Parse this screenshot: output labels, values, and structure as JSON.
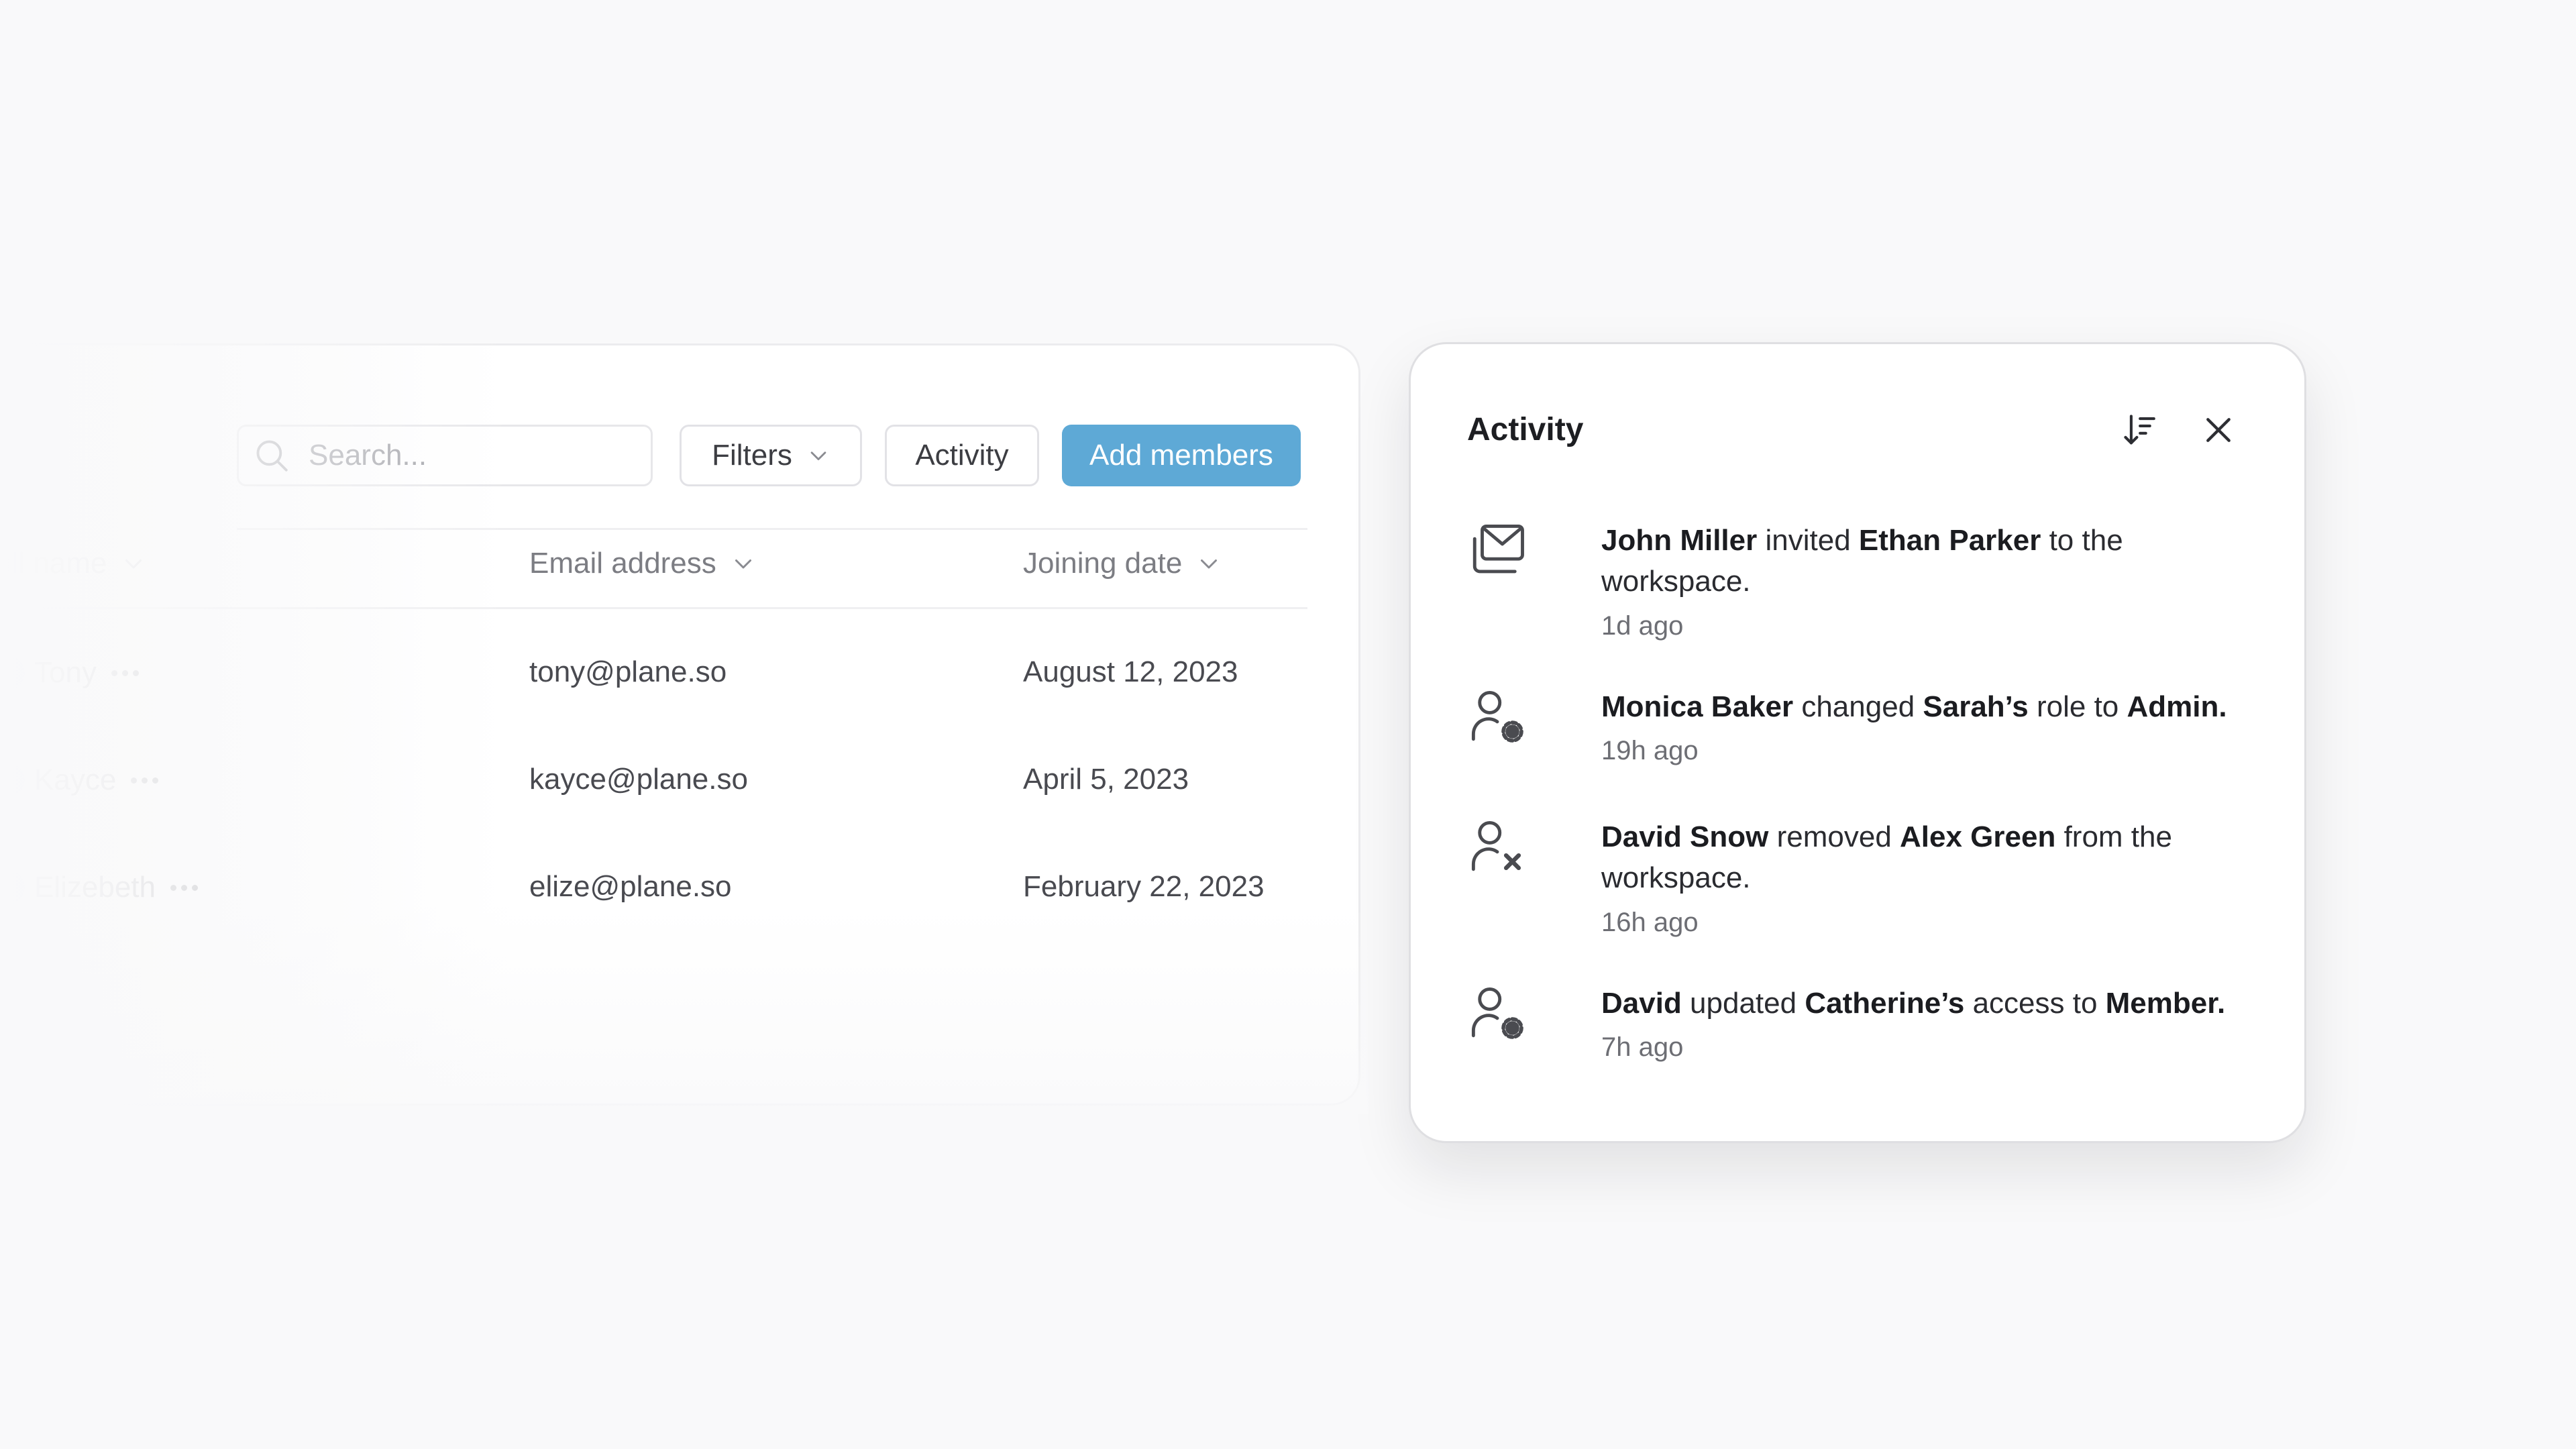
{
  "toolbar": {
    "search_placeholder": "Search...",
    "filters_label": "Filters",
    "activity_label": "Activity",
    "add_members_label": "Add members"
  },
  "table": {
    "columns": [
      "ull name",
      "Email address",
      "Joining date"
    ],
    "rows": [
      {
        "name": "Tony",
        "email": "tony@plane.so",
        "date": "August 12, 2023"
      },
      {
        "name": "Kayce",
        "email": "kayce@plane.so",
        "date": "April 5, 2023"
      },
      {
        "name": "Elizebeth",
        "email": "elize@plane.so",
        "date": "February 22, 2023"
      }
    ]
  },
  "activity": {
    "title": "Activity",
    "items": [
      {
        "icon": "mail-icon",
        "actor": "John Miller",
        "verb": " invited ",
        "target": "Ethan Parker",
        "mid": " to the workspace.",
        "value": "",
        "end": "",
        "time": "1d ago"
      },
      {
        "icon": "user-settings-icon",
        "actor": "Monica Baker",
        "verb": " changed ",
        "target": "Sarah’s",
        "mid": " role to ",
        "value": "Admin.",
        "end": "",
        "time": "19h ago"
      },
      {
        "icon": "user-remove-icon",
        "actor": "David Snow",
        "verb": " removed ",
        "target": "Alex Green",
        "mid": " from the workspace.",
        "value": "",
        "end": "",
        "time": "16h ago"
      },
      {
        "icon": "user-settings-icon",
        "actor": "David",
        "verb": " updated ",
        "target": "Catherine’s",
        "mid": " access to ",
        "value": "Member.",
        "end": "",
        "time": "7h ago"
      }
    ]
  },
  "colors": {
    "accent": "#5ea9d6",
    "background": "#f9f9fa",
    "panel": "#ffffff"
  }
}
